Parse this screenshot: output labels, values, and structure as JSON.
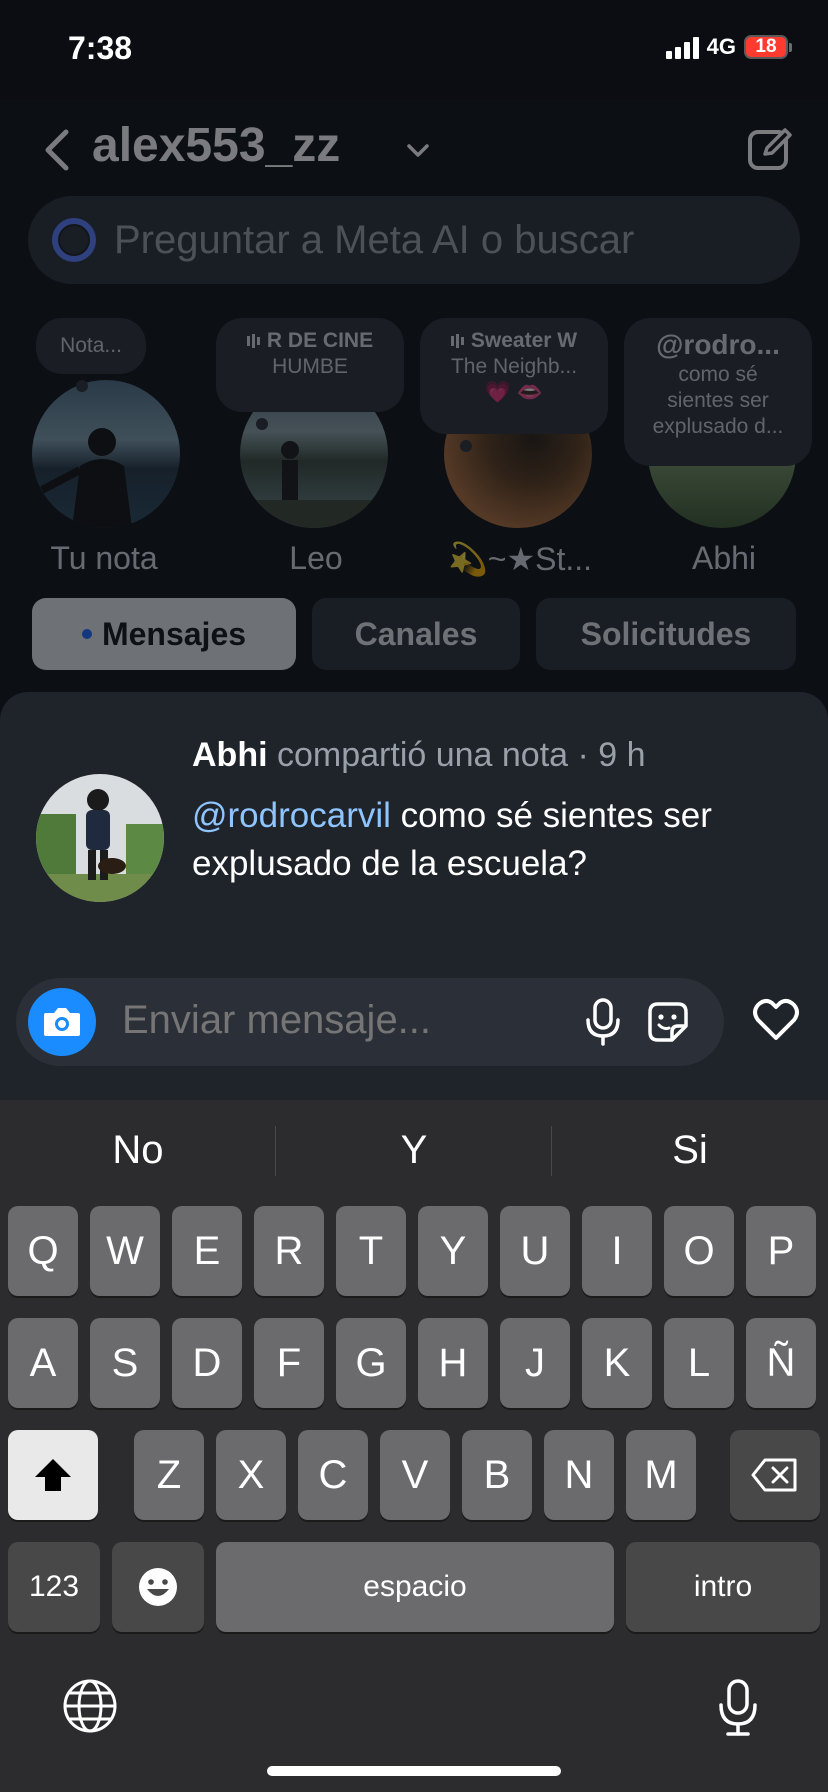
{
  "status": {
    "time": "7:38",
    "network": "4G",
    "battery": "18"
  },
  "header": {
    "username": "alex553_zz"
  },
  "search": {
    "placeholder": "Preguntar a Meta AI o buscar"
  },
  "notes": [
    {
      "bubble": "Nota...",
      "label": "Tu nota"
    },
    {
      "bubble_line1": "R DE CINE",
      "bubble_line2": "HUMBE",
      "label": "Leo"
    },
    {
      "bubble_line1": "Sweater W",
      "bubble_line2": "The Neighb...",
      "bubble_line3": "💗 👄",
      "label": "💫~★St..."
    },
    {
      "bubble_line1": "@rodro...",
      "bubble_line2": "como sé",
      "bubble_line3": "sientes ser",
      "bubble_line4": "explusado d...",
      "label": "Abhi"
    }
  ],
  "tabs": [
    {
      "label": "Mensajes",
      "active": true
    },
    {
      "label": "Canales"
    },
    {
      "label": "Solicitudes"
    }
  ],
  "note_detail": {
    "author": "Abhi",
    "meta": "compartió una nota · 9 h",
    "mention": "@rodrocarvil",
    "text": " como sé sientes ser explusado de la escuela?"
  },
  "composer": {
    "placeholder": "Enviar mensaje..."
  },
  "keyboard": {
    "suggestions": [
      "No",
      "Y",
      "Si"
    ],
    "row1": [
      "Q",
      "W",
      "E",
      "R",
      "T",
      "Y",
      "U",
      "I",
      "O",
      "P"
    ],
    "row2": [
      "A",
      "S",
      "D",
      "F",
      "G",
      "H",
      "J",
      "K",
      "L",
      "Ñ"
    ],
    "row3": [
      "Z",
      "X",
      "C",
      "V",
      "B",
      "N",
      "M"
    ],
    "numbers_label": "123",
    "space_label": "espacio",
    "return_label": "intro"
  },
  "colors": {
    "accent": "#1a8cff",
    "mention": "#8fc5ff",
    "battery_low": "#ff3b30"
  }
}
